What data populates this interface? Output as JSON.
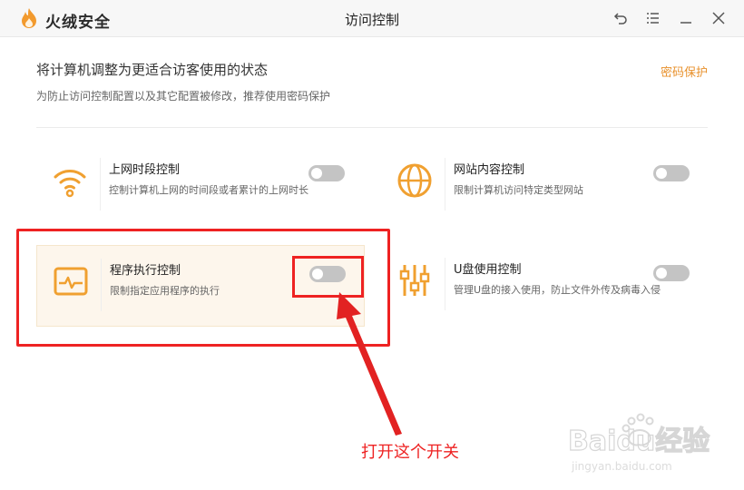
{
  "app": {
    "brand": "火绒安全",
    "window_title": "访问控制"
  },
  "header": {
    "title": "将计算机调整为更适合访客使用的状态",
    "subtitle": "为防止访问控制配置以及其它配置被修改，推荐使用密码保护",
    "password_link": "密码保护"
  },
  "controls": [
    {
      "title": "上网时段控制",
      "desc": "控制计算机上网的时间段或者累计的上网时长",
      "icon": "wifi-icon",
      "enabled": false
    },
    {
      "title": "网站内容控制",
      "desc": "限制计算机访问特定类型网站",
      "icon": "globe-icon",
      "enabled": false
    },
    {
      "title": "程序执行控制",
      "desc": "限制指定应用程序的执行",
      "icon": "program-monitor-icon",
      "enabled": false
    },
    {
      "title": "U盘使用控制",
      "desc": "管理U盘的接入使用，防止文件外传及病毒入侵",
      "icon": "sliders-icon",
      "enabled": false
    }
  ],
  "annotation": {
    "text": "打开这个开关"
  },
  "watermark": {
    "brand": "Baidu经验",
    "url": "jingyan.baidu.com"
  },
  "colors": {
    "accent": "#e8912c",
    "icon": "#f0a030",
    "annotation": "#e22222",
    "toggle_off": "#c4c4c4"
  }
}
